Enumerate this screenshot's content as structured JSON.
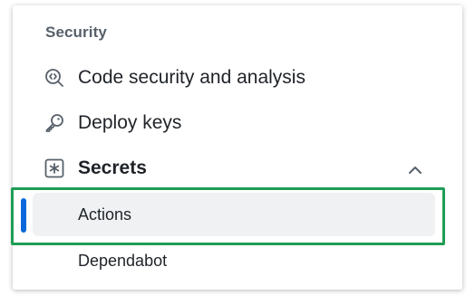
{
  "sidebar": {
    "section_title": "Security",
    "items": [
      {
        "label": "Code security and analysis",
        "icon": "codescan-icon"
      },
      {
        "label": "Deploy keys",
        "icon": "key-icon"
      },
      {
        "label": "Secrets",
        "icon": "key-asterisk-icon",
        "expanded": true
      }
    ],
    "secrets_subitems": [
      {
        "label": "Actions",
        "selected": true
      },
      {
        "label": "Dependabot",
        "selected": false
      }
    ]
  },
  "colors": {
    "accent": "#0969da",
    "highlight_border": "#1f9d55",
    "selected_bg": "#eff1f3",
    "heading": "#57606a"
  }
}
